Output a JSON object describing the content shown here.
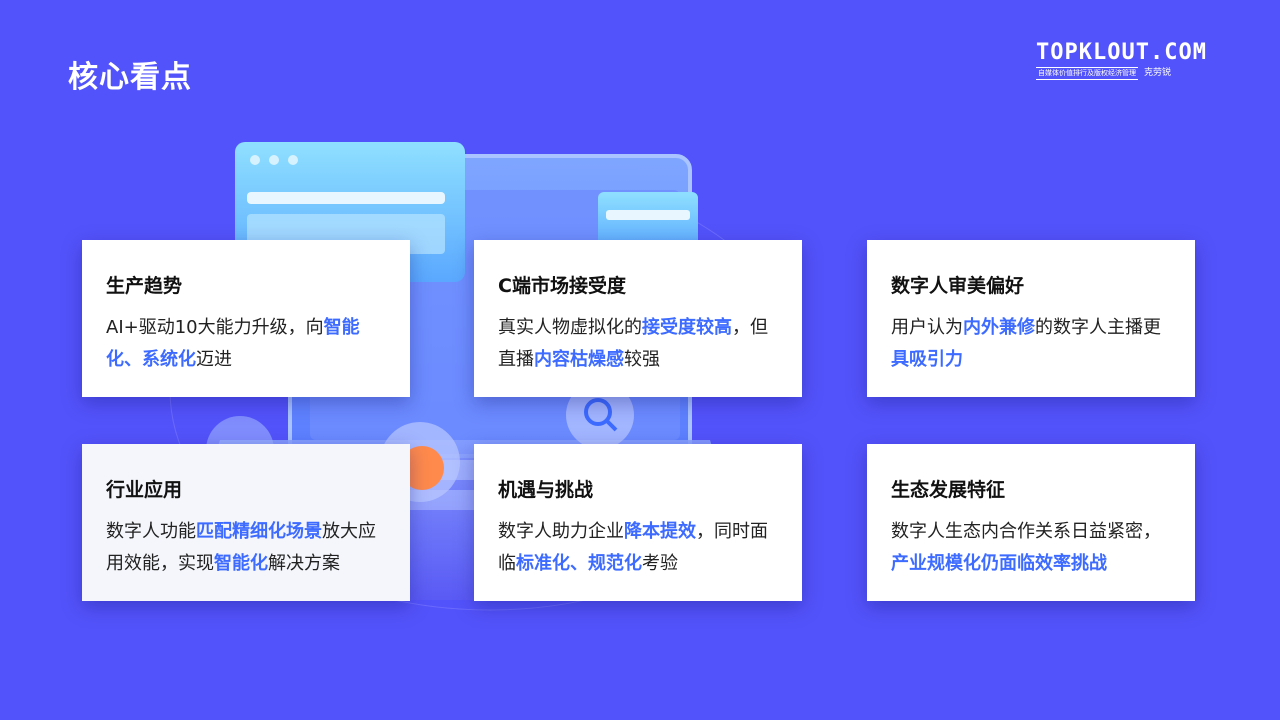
{
  "header": {
    "title": "核心看点",
    "logo_main": "TOPKLOUT.COM",
    "logo_sub": "自媒体价值排行及版权经济管理",
    "logo_sub2": "克劳锐"
  },
  "colors": {
    "background": "#5353fb",
    "highlight": "#3d6bff",
    "card": "#ffffff"
  },
  "cards": [
    {
      "title": "生产趋势",
      "body": [
        {
          "t": "AI+驱动10大能力升级，向",
          "hl": false
        },
        {
          "t": "智能化、系统化",
          "hl": true
        },
        {
          "t": "迈进",
          "hl": false
        }
      ]
    },
    {
      "title": "C端市场接受度",
      "body": [
        {
          "t": "真实人物虚拟化的",
          "hl": false
        },
        {
          "t": "接受度较高",
          "hl": true
        },
        {
          "t": "，但直播",
          "hl": false
        },
        {
          "t": "内容枯燥感",
          "hl": true
        },
        {
          "t": "较强",
          "hl": false
        }
      ]
    },
    {
      "title": "数字人审美偏好",
      "body": [
        {
          "t": "用户认为",
          "hl": false
        },
        {
          "t": "内外兼修",
          "hl": true
        },
        {
          "t": "的数字人主播更",
          "hl": false
        },
        {
          "t": "具吸引力",
          "hl": true
        }
      ]
    },
    {
      "title": "行业应用",
      "body": [
        {
          "t": "数字人功能",
          "hl": false
        },
        {
          "t": "匹配精细化场景",
          "hl": true
        },
        {
          "t": "放大应用效能，实现",
          "hl": false
        },
        {
          "t": "智能化",
          "hl": true
        },
        {
          "t": "解决方案",
          "hl": false
        }
      ]
    },
    {
      "title": "机遇与挑战",
      "body": [
        {
          "t": "数字人助力企业",
          "hl": false
        },
        {
          "t": "降本提效",
          "hl": true
        },
        {
          "t": "，同时面临",
          "hl": false
        },
        {
          "t": "标准化、规范化",
          "hl": true
        },
        {
          "t": "考验",
          "hl": false
        }
      ]
    },
    {
      "title": "生态发展特征",
      "body": [
        {
          "t": "数字人生态内合作关系日益紧密，",
          "hl": false
        },
        {
          "t": "产业规模化仍面临效率挑战",
          "hl": true
        }
      ]
    }
  ]
}
